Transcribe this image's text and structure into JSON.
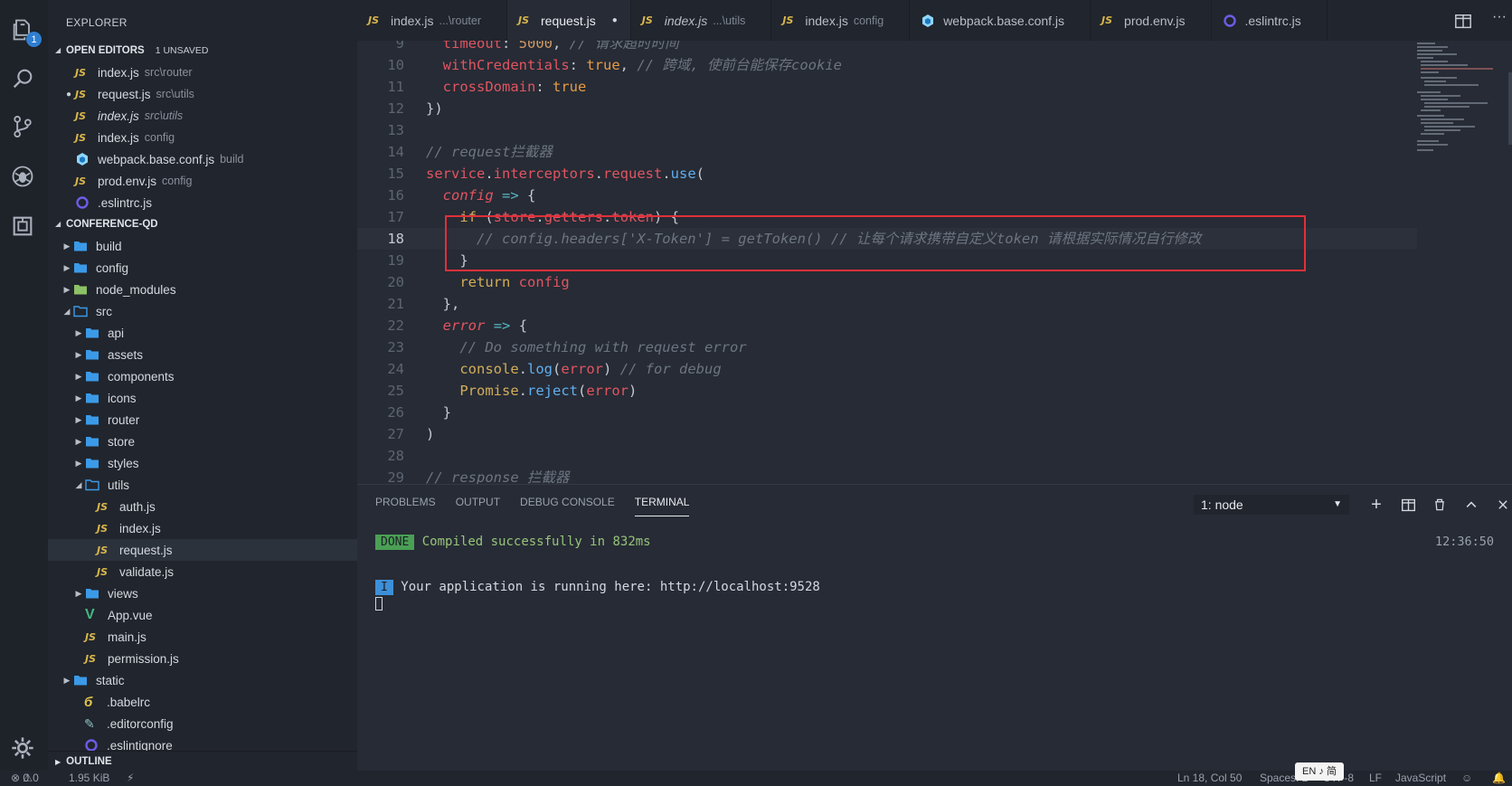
{
  "activity_bar": {
    "explorer_badge": "1",
    "icons": [
      "files-icon",
      "search-icon",
      "source-control-icon",
      "debug-icon",
      "extensions-icon",
      "settings-gear-icon"
    ]
  },
  "sidebar": {
    "title": "EXPLORER",
    "open_editors": {
      "label": "OPEN EDITORS",
      "unsaved": "1 UNSAVED",
      "items": [
        {
          "name": "index.js",
          "desc": "src\\router",
          "icon": "js",
          "dirty": false,
          "italic": false
        },
        {
          "name": "request.js",
          "desc": "src\\utils",
          "icon": "js",
          "dirty": true,
          "italic": false
        },
        {
          "name": "index.js",
          "desc": "src\\utils",
          "icon": "js",
          "dirty": false,
          "italic": true
        },
        {
          "name": "index.js",
          "desc": "config",
          "icon": "js",
          "dirty": false,
          "italic": false
        },
        {
          "name": "webpack.base.conf.js",
          "desc": "build",
          "icon": "webpack",
          "dirty": false,
          "italic": false
        },
        {
          "name": "prod.env.js",
          "desc": "config",
          "icon": "js",
          "dirty": false,
          "italic": false
        },
        {
          "name": ".eslintrc.js",
          "desc": "",
          "icon": "eslint",
          "dirty": false,
          "italic": false
        }
      ]
    },
    "project": {
      "label": "CONFERENCE-QD",
      "tree": [
        {
          "name": "build",
          "type": "folder",
          "depth": 0,
          "open": false
        },
        {
          "name": "config",
          "type": "folder",
          "depth": 0,
          "open": false
        },
        {
          "name": "node_modules",
          "type": "node-folder",
          "depth": 0,
          "open": false
        },
        {
          "name": "src",
          "type": "folder-open",
          "depth": 0,
          "open": true
        },
        {
          "name": "api",
          "type": "folder",
          "depth": 1,
          "open": false
        },
        {
          "name": "assets",
          "type": "folder",
          "depth": 1,
          "open": false
        },
        {
          "name": "components",
          "type": "folder",
          "depth": 1,
          "open": false
        },
        {
          "name": "icons",
          "type": "folder",
          "depth": 1,
          "open": false
        },
        {
          "name": "router",
          "type": "folder",
          "depth": 1,
          "open": false
        },
        {
          "name": "store",
          "type": "folder",
          "depth": 1,
          "open": false
        },
        {
          "name": "styles",
          "type": "folder",
          "depth": 1,
          "open": false
        },
        {
          "name": "utils",
          "type": "folder-open",
          "depth": 1,
          "open": true
        },
        {
          "name": "auth.js",
          "type": "js",
          "depth": 2
        },
        {
          "name": "index.js",
          "type": "js",
          "depth": 2
        },
        {
          "name": "request.js",
          "type": "js",
          "depth": 2,
          "active": true
        },
        {
          "name": "validate.js",
          "type": "js",
          "depth": 2
        },
        {
          "name": "views",
          "type": "folder",
          "depth": 1,
          "open": false
        },
        {
          "name": "App.vue",
          "type": "vue",
          "depth": 1
        },
        {
          "name": "main.js",
          "type": "js",
          "depth": 1
        },
        {
          "name": "permission.js",
          "type": "js",
          "depth": 1
        },
        {
          "name": "static",
          "type": "folder",
          "depth": 0,
          "open": false
        },
        {
          "name": ".babelrc",
          "type": "babel",
          "depth": 0
        },
        {
          "name": ".editorconfig",
          "type": "editorconfig",
          "depth": 0
        },
        {
          "name": ".eslintignore",
          "type": "eslint",
          "depth": 0
        }
      ]
    },
    "outline_label": "OUTLINE"
  },
  "tabs": [
    {
      "name": "index.js",
      "desc": "...\\router",
      "icon": "js",
      "active": false,
      "dirty": false,
      "italic": false
    },
    {
      "name": "request.js",
      "desc": "",
      "icon": "js",
      "active": true,
      "dirty": true,
      "italic": false
    },
    {
      "name": "index.js",
      "desc": "...\\utils",
      "icon": "js",
      "active": false,
      "dirty": false,
      "italic": true
    },
    {
      "name": "index.js",
      "desc": "config",
      "icon": "js",
      "active": false,
      "dirty": false,
      "italic": false
    },
    {
      "name": "webpack.base.conf.js",
      "desc": "",
      "icon": "webpack",
      "active": false,
      "dirty": false,
      "italic": false
    },
    {
      "name": "prod.env.js",
      "desc": "",
      "icon": "js",
      "active": false,
      "dirty": false,
      "italic": false
    },
    {
      "name": ".eslintrc.js",
      "desc": "",
      "icon": "eslint",
      "active": false,
      "dirty": false,
      "italic": false
    }
  ],
  "editor": {
    "current_line": 18,
    "lines": [
      {
        "n": "9",
        "tokens": [
          [
            "t",
            "  "
          ],
          [
            "p",
            "timeout"
          ],
          [
            "t",
            ": "
          ],
          [
            "n",
            "5000"
          ],
          [
            "t",
            ", "
          ],
          [
            "c",
            "// 请求超时时间"
          ]
        ]
      },
      {
        "n": "10",
        "tokens": [
          [
            "t",
            "  "
          ],
          [
            "p",
            "withCredentials"
          ],
          [
            "t",
            ": "
          ],
          [
            "b",
            "true"
          ],
          [
            "t",
            ", "
          ],
          [
            "c",
            "// 跨域, 使前台能保存cookie"
          ]
        ]
      },
      {
        "n": "11",
        "tokens": [
          [
            "t",
            "  "
          ],
          [
            "p",
            "crossDomain"
          ],
          [
            "t",
            ": "
          ],
          [
            "b",
            "true"
          ]
        ]
      },
      {
        "n": "12",
        "tokens": [
          [
            "t",
            "})"
          ]
        ]
      },
      {
        "n": "13",
        "tokens": []
      },
      {
        "n": "14",
        "tokens": [
          [
            "c",
            "// request拦截器"
          ]
        ]
      },
      {
        "n": "15",
        "tokens": [
          [
            "p",
            "service"
          ],
          [
            "t",
            "."
          ],
          [
            "p",
            "interceptors"
          ],
          [
            "t",
            "."
          ],
          [
            "p",
            "request"
          ],
          [
            "t",
            "."
          ],
          [
            "f",
            "use"
          ],
          [
            "t",
            "("
          ]
        ]
      },
      {
        "n": "16",
        "tokens": [
          [
            "t",
            "  "
          ],
          [
            "v",
            "config"
          ],
          [
            "t",
            " "
          ],
          [
            "o",
            "=>"
          ],
          [
            "t",
            " {"
          ]
        ]
      },
      {
        "n": "17",
        "tokens": [
          [
            "t",
            "    "
          ],
          [
            "k",
            "if"
          ],
          [
            "t",
            " ("
          ],
          [
            "p",
            "store"
          ],
          [
            "t",
            "."
          ],
          [
            "p",
            "getters"
          ],
          [
            "t",
            "."
          ],
          [
            "p",
            "token"
          ],
          [
            "t",
            ") {"
          ]
        ]
      },
      {
        "n": "18",
        "tokens": [
          [
            "t",
            "      "
          ],
          [
            "c",
            "// config.headers['X-Token'] = getToken() // 让每个请求携带自定义token 请根据实际情况自行修改"
          ]
        ]
      },
      {
        "n": "19",
        "tokens": [
          [
            "t",
            "    }"
          ]
        ]
      },
      {
        "n": "20",
        "tokens": [
          [
            "t",
            "    "
          ],
          [
            "k",
            "return"
          ],
          [
            "t",
            " "
          ],
          [
            "p",
            "config"
          ]
        ]
      },
      {
        "n": "21",
        "tokens": [
          [
            "t",
            "  },"
          ]
        ]
      },
      {
        "n": "22",
        "tokens": [
          [
            "t",
            "  "
          ],
          [
            "v",
            "error"
          ],
          [
            "t",
            " "
          ],
          [
            "o",
            "=>"
          ],
          [
            "t",
            " {"
          ]
        ]
      },
      {
        "n": "23",
        "tokens": [
          [
            "t",
            "    "
          ],
          [
            "c",
            "// Do something with request error"
          ]
        ]
      },
      {
        "n": "24",
        "tokens": [
          [
            "t",
            "    "
          ],
          [
            "k",
            "console"
          ],
          [
            "t",
            "."
          ],
          [
            "f",
            "log"
          ],
          [
            "t",
            "("
          ],
          [
            "p",
            "error"
          ],
          [
            "t",
            ") "
          ],
          [
            "c",
            "// for debug"
          ]
        ]
      },
      {
        "n": "25",
        "tokens": [
          [
            "t",
            "    "
          ],
          [
            "k",
            "Promise"
          ],
          [
            "t",
            "."
          ],
          [
            "f",
            "reject"
          ],
          [
            "t",
            "("
          ],
          [
            "p",
            "error"
          ],
          [
            "t",
            ")"
          ]
        ]
      },
      {
        "n": "26",
        "tokens": [
          [
            "t",
            "  }"
          ]
        ]
      },
      {
        "n": "27",
        "tokens": [
          [
            "t",
            ")"
          ]
        ]
      },
      {
        "n": "28",
        "tokens": []
      },
      {
        "n": "29",
        "tokens": [
          [
            "c",
            "// response 拦截器"
          ]
        ]
      }
    ]
  },
  "panel": {
    "tabs": [
      {
        "label": "PROBLEMS",
        "active": false
      },
      {
        "label": "OUTPUT",
        "active": false
      },
      {
        "label": "DEBUG CONSOLE",
        "active": false
      },
      {
        "label": "TERMINAL",
        "active": true
      }
    ],
    "terminal_select": "1: node",
    "timestamp": "12:36:50",
    "done_badge": "DONE",
    "done_text": "Compiled successfully in 832ms",
    "info_badge": "I",
    "info_text": "Your application is running here: http://localhost:9528"
  },
  "status_bar": {
    "errors": "0",
    "warnings": "0",
    "size": "1.95 KiB",
    "position": "Ln 18, Col 50",
    "spaces": "Spaces: 2",
    "encoding": "UTF-8",
    "eol": "LF",
    "language": "JavaScript",
    "ime": "EN ♪ 简"
  },
  "colors": {
    "highlight_box": "#e0303a",
    "folder": "#3b9ae8",
    "js": "#d8b64c"
  }
}
